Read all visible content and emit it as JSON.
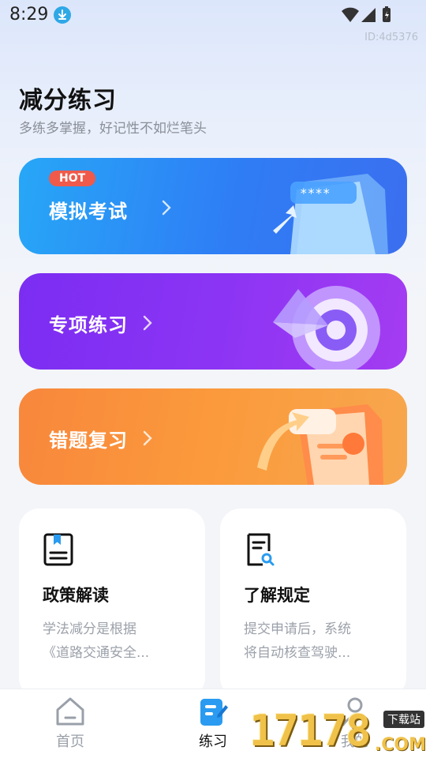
{
  "status_bar": {
    "time": "8:29"
  },
  "page_id": "ID:4d5376",
  "header": {
    "title": "减分练习",
    "subtitle": "多练多掌握，好记性不如烂笔头"
  },
  "cards": {
    "mock_exam": {
      "label": "模拟考试",
      "badge": "HOT"
    },
    "topic_practice": {
      "label": "专项练习"
    },
    "wrong_review": {
      "label": "错题复习"
    }
  },
  "info_cards": {
    "policy": {
      "title": "政策解读",
      "desc_line1": "学法减分是根据",
      "desc_line2": "《道路交通安全..."
    },
    "rules": {
      "title": "了解规定",
      "desc_line1": "提交申请后，系统",
      "desc_line2": "将自动核查驾驶..."
    }
  },
  "tabs": {
    "home": "首页",
    "practice": "练习",
    "mine": "我的"
  },
  "watermark": {
    "digits": "17178",
    "tag": "下载站",
    "suffix": ".COM"
  },
  "colors": {
    "mock_card": "#2f7df5",
    "topic_card": "#8b34f4",
    "wrong_card": "#fb9a3c",
    "hot_badge": "#ef5a4a",
    "active_tab_icon": "#2a9bf0"
  }
}
